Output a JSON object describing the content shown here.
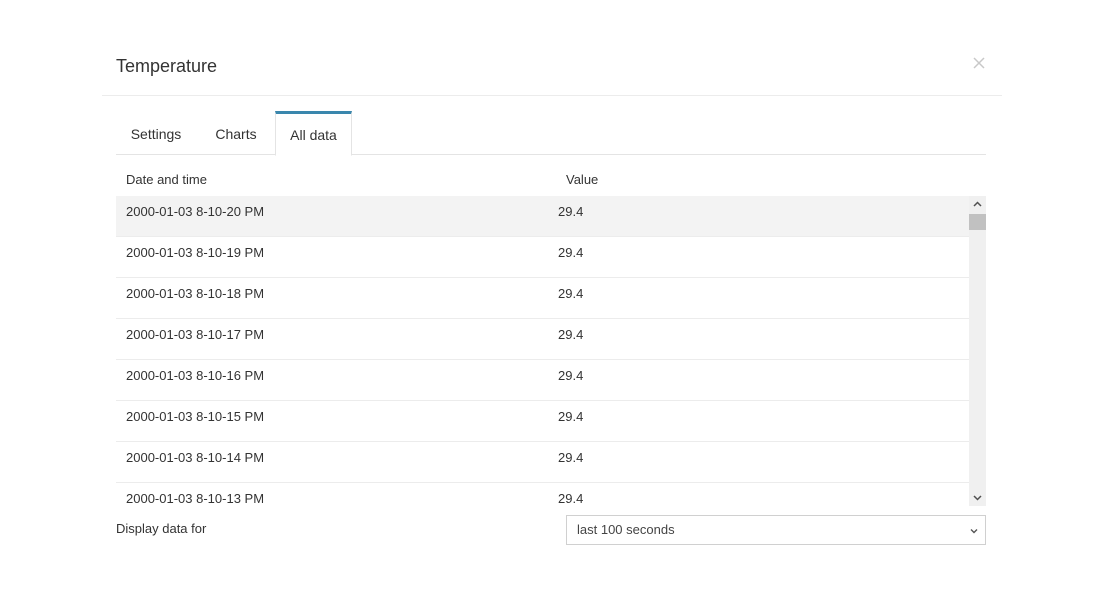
{
  "dialog": {
    "title": "Temperature",
    "close_icon": "close-icon"
  },
  "tabs": [
    {
      "label": "Settings",
      "active": false
    },
    {
      "label": "Charts",
      "active": false
    },
    {
      "label": "All data",
      "active": true
    }
  ],
  "table": {
    "columns": [
      "Date and time",
      "Value"
    ],
    "rows": [
      {
        "date": "2000-01-03 8-10-20 PM",
        "value": "29.4",
        "selected": true
      },
      {
        "date": "2000-01-03 8-10-19 PM",
        "value": "29.4"
      },
      {
        "date": "2000-01-03 8-10-18 PM",
        "value": "29.4"
      },
      {
        "date": "2000-01-03 8-10-17 PM",
        "value": "29.4"
      },
      {
        "date": "2000-01-03 8-10-16 PM",
        "value": "29.4"
      },
      {
        "date": "2000-01-03 8-10-15 PM",
        "value": "29.4"
      },
      {
        "date": "2000-01-03 8-10-14 PM",
        "value": "29.4"
      },
      {
        "date": "2000-01-03 8-10-13 PM",
        "value": "29.4"
      }
    ]
  },
  "footer": {
    "label": "Display data for",
    "select_value": "last 100 seconds"
  },
  "colors": {
    "active_tab_accent": "#3a87ad",
    "selected_row_bg": "#f3f3f3"
  }
}
